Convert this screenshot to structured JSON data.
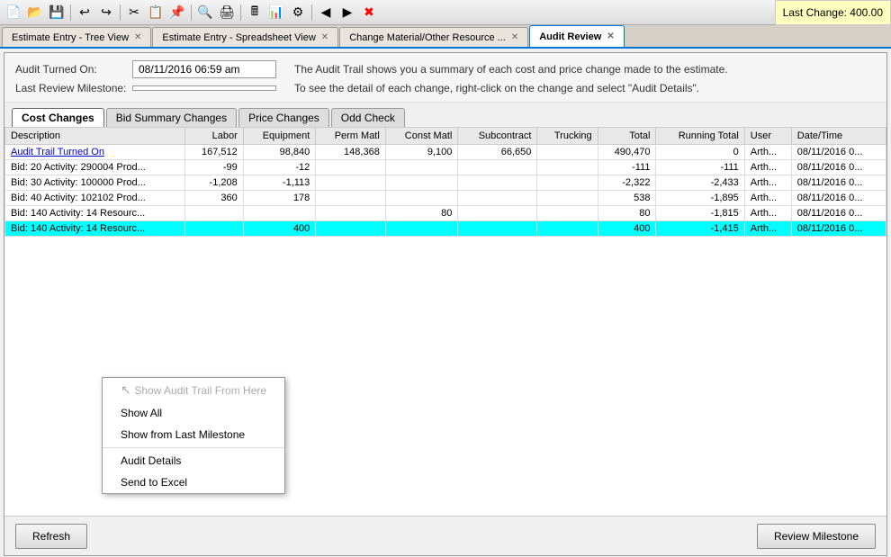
{
  "toolbar": {
    "last_change": "Last Change: 400.00"
  },
  "tabs": [
    {
      "label": "Estimate Entry - Tree View",
      "active": false,
      "closable": true
    },
    {
      "label": "Estimate Entry - Spreadsheet View",
      "active": false,
      "closable": true
    },
    {
      "label": "Change Material/Other Resource ...",
      "active": false,
      "closable": true
    },
    {
      "label": "Audit Review",
      "active": true,
      "closable": true
    }
  ],
  "header": {
    "audit_turned_on_label": "Audit Turned On:",
    "audit_turned_on_value": "08/11/2016 06:59 am",
    "last_review_label": "Last Review Milestone:",
    "last_review_value": "",
    "desc_line1": "The Audit Trail shows you a summary of each cost and price change made to the estimate.",
    "desc_line2": "To see the detail of each change, right-click on the change and select \"Audit Details\"."
  },
  "sub_tabs": [
    {
      "label": "Cost Changes",
      "active": true
    },
    {
      "label": "Bid Summary Changes",
      "active": false
    },
    {
      "label": "Price Changes",
      "active": false
    },
    {
      "label": "Odd Check",
      "active": false
    }
  ],
  "table": {
    "columns": [
      "Description",
      "Labor",
      "Equipment",
      "Perm Matl",
      "Const Matl",
      "Subcontract",
      "Trucking",
      "Total",
      "Running Total",
      "User",
      "Date/Time"
    ],
    "rows": [
      {
        "description": "Audit Trail Turned On",
        "labor": "167,512",
        "equipment": "98,840",
        "perm_matl": "148,368",
        "const_matl": "9,100",
        "subcontract": "66,650",
        "trucking": "",
        "total": "490,470",
        "running_total": "0",
        "user": "Arth...",
        "date_time": "08/11/2016 0...",
        "is_link": true,
        "highlight": false
      },
      {
        "description": "Bid: 20 Activity: 290004 Prod...",
        "labor": "-99",
        "equipment": "-12",
        "perm_matl": "",
        "const_matl": "",
        "subcontract": "",
        "trucking": "",
        "total": "-111",
        "running_total": "-111",
        "user": "Arth...",
        "date_time": "08/11/2016 0...",
        "is_link": false,
        "highlight": false
      },
      {
        "description": "Bid: 30 Activity: 100000 Prod...",
        "labor": "-1,208",
        "equipment": "-1,113",
        "perm_matl": "",
        "const_matl": "",
        "subcontract": "",
        "trucking": "",
        "total": "-2,322",
        "running_total": "-2,433",
        "user": "Arth...",
        "date_time": "08/11/2016 0...",
        "is_link": false,
        "highlight": false
      },
      {
        "description": "Bid: 40 Activity: 102102 Prod...",
        "labor": "360",
        "equipment": "178",
        "perm_matl": "",
        "const_matl": "",
        "subcontract": "",
        "trucking": "",
        "total": "538",
        "running_total": "-1,895",
        "user": "Arth...",
        "date_time": "08/11/2016 0...",
        "is_link": false,
        "highlight": false
      },
      {
        "description": "Bid: 140 Activity: 14 Resourc...",
        "labor": "",
        "equipment": "",
        "perm_matl": "",
        "const_matl": "80",
        "subcontract": "",
        "trucking": "",
        "total": "80",
        "running_total": "-1,815",
        "user": "Arth...",
        "date_time": "08/11/2016 0...",
        "is_link": false,
        "highlight": false
      },
      {
        "description": "Bid: 140 Activity: 14 Resourc...",
        "labor": "",
        "equipment": "400",
        "perm_matl": "",
        "const_matl": "",
        "subcontract": "",
        "trucking": "",
        "total": "400",
        "running_total": "-1,415",
        "user": "Arth...",
        "date_time": "08/11/2016 0...",
        "is_link": false,
        "highlight": true
      }
    ]
  },
  "context_menu": {
    "items": [
      {
        "label": "Show Audit Trail From Here",
        "disabled": true
      },
      {
        "label": "Show All",
        "disabled": false
      },
      {
        "label": "Show from Last Milestone",
        "disabled": false
      },
      {
        "label": "Audit Details",
        "disabled": false
      },
      {
        "label": "Send to Excel",
        "disabled": false
      }
    ]
  },
  "bottom": {
    "refresh_label": "Refresh",
    "review_milestone_label": "Review Milestone"
  }
}
